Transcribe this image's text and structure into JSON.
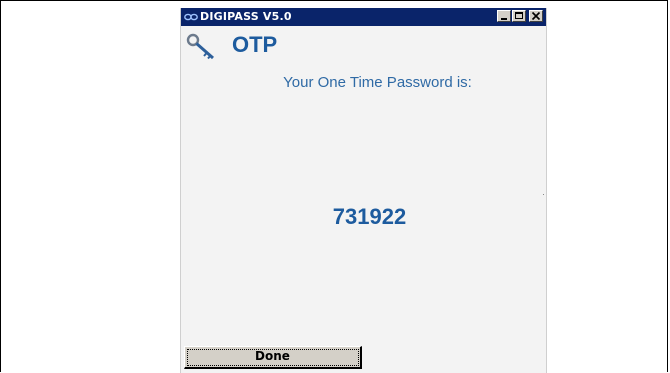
{
  "window": {
    "title": "DIGIPASS V5.0",
    "titlebar_color": "#0a246a",
    "app_icon": "digipass-logo-icon"
  },
  "controls": {
    "minimize_icon": "minimize-icon",
    "maximize_icon": "maximize-icon",
    "close_icon": "close-icon"
  },
  "header": {
    "icon": "key-icon",
    "title": "OTP"
  },
  "main": {
    "prompt": "Your One Time Password is:",
    "otp": "731922",
    "accent_color": "#1d5b9e"
  },
  "footer": {
    "done_label": "Done"
  }
}
